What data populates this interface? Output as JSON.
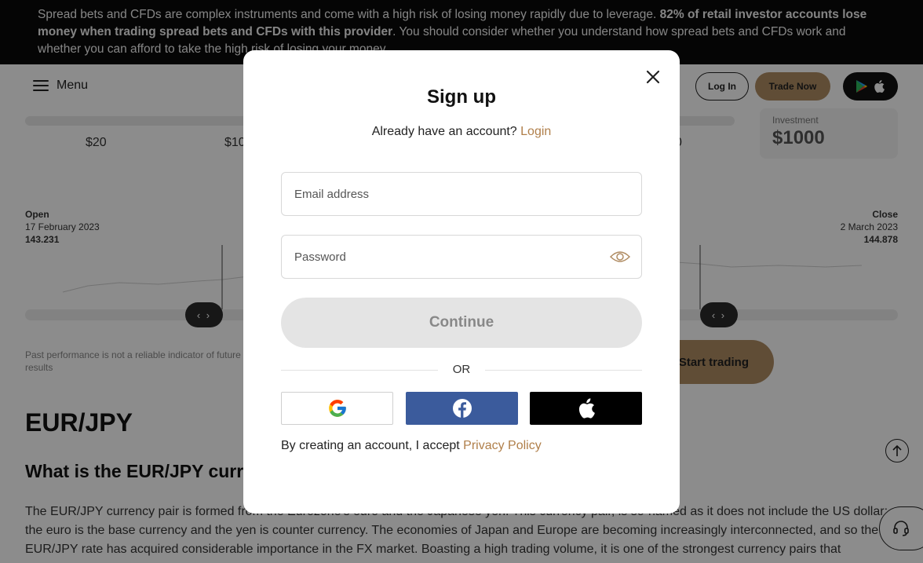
{
  "banner": {
    "text_normal_1": "Spread bets and CFDs are complex instruments and come with a high risk of losing money rapidly due to leverage. ",
    "text_bold": "82% of retail investor accounts lose money when trading spread bets and CFDs with this provider",
    "text_normal_2": ". You should consider whether you understand how spread bets and CFDs work and whether you can afford to take the high risk of losing your money."
  },
  "header": {
    "menu_label": "Menu",
    "login_label": "Log In",
    "trade_label": "Trade Now",
    "menu_icon": "hamburger-icon",
    "store_icons": [
      "google-play-icon",
      "apple-icon"
    ]
  },
  "calculator": {
    "amounts": [
      "$20",
      "$10",
      "0"
    ],
    "investment_label": "Investment",
    "investment_value": "$1000"
  },
  "chart": {
    "open_title": "Open",
    "open_date": "17 February 2023",
    "open_value": "143.231",
    "close_title": "Close",
    "close_date": "2 March 2023",
    "close_value": "144.878"
  },
  "past_performance": "Past performance is not a reliable indicator of future results",
  "start_trading_label": "Start trading",
  "article": {
    "title": "EUR/JPY",
    "subtitle": "What is the EUR/JPY currency pair?",
    "paragraph": "The EUR/JPY currency pair is formed from the Eurozone's euro and the Japanese yen. This currency pair, is so-named as it does not include the US dollar: the euro is the base currency and the yen is counter currency. The economies of Japan and Europe are becoming increasingly interconnected, and so the EUR/JPY rate has acquired considerable importance in the FX market. Boasting a high trading volume, it is one of the strongest currency pairs that"
  },
  "modal": {
    "title": "Sign up",
    "already_text": "Already have an account?",
    "login_link": "Login",
    "email_placeholder": "Email address",
    "password_placeholder": "Password",
    "continue_label": "Continue",
    "or_label": "OR",
    "terms_text": "By creating an account, I accept",
    "privacy_link": "Privacy Policy"
  },
  "colors": {
    "accent": "#b08c63",
    "link": "#b07f4a",
    "facebook": "#3b5b9c",
    "banner_bg": "#0a0a0a"
  }
}
